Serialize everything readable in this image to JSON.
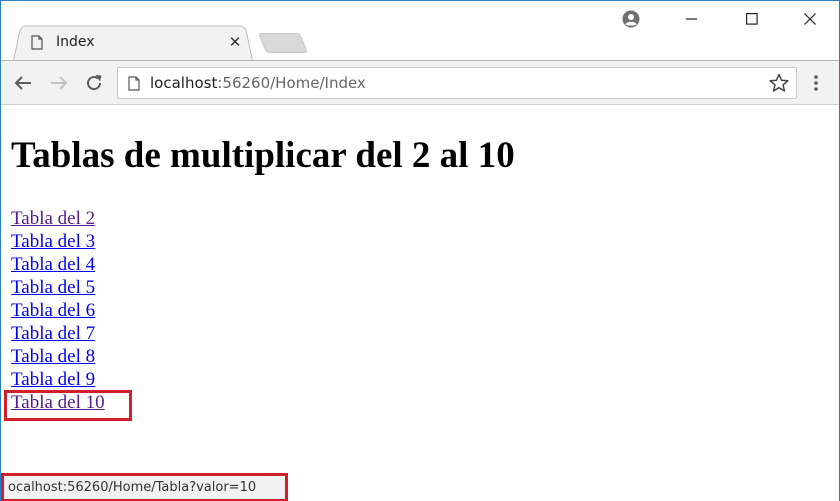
{
  "tab": {
    "title": "Index",
    "close_label": "✕"
  },
  "icons": {
    "page": "page-icon",
    "profile": "profile-icon",
    "back": "back-arrow-icon",
    "forward": "forward-arrow-icon",
    "reload": "reload-icon",
    "star": "star-icon",
    "menu": "kebab-menu-icon",
    "minimize": "minimize-icon",
    "maximize": "maximize-icon",
    "close": "close-icon"
  },
  "address_bar": {
    "host": "localhost",
    "rest": ":56260/Home/Index"
  },
  "page": {
    "heading": "Tablas de multiplicar del 2 al 10",
    "links": [
      {
        "label": "Tabla del 2",
        "visited": true
      },
      {
        "label": "Tabla del 3",
        "visited": false
      },
      {
        "label": "Tabla del 4",
        "visited": false
      },
      {
        "label": "Tabla del 5",
        "visited": false
      },
      {
        "label": "Tabla del 6",
        "visited": false
      },
      {
        "label": "Tabla del 7",
        "visited": false
      },
      {
        "label": "Tabla del 8",
        "visited": false
      },
      {
        "label": "Tabla del 9",
        "visited": false
      },
      {
        "label": "Tabla del 10",
        "visited": true
      }
    ]
  },
  "status_bar": {
    "text": "ocalhost:56260/Home/Tabla?valor=10"
  },
  "colors": {
    "link": "#0000ee",
    "visited_link": "#551a8b",
    "highlight": "#d0202a",
    "window_border": "#2b7fc2"
  }
}
